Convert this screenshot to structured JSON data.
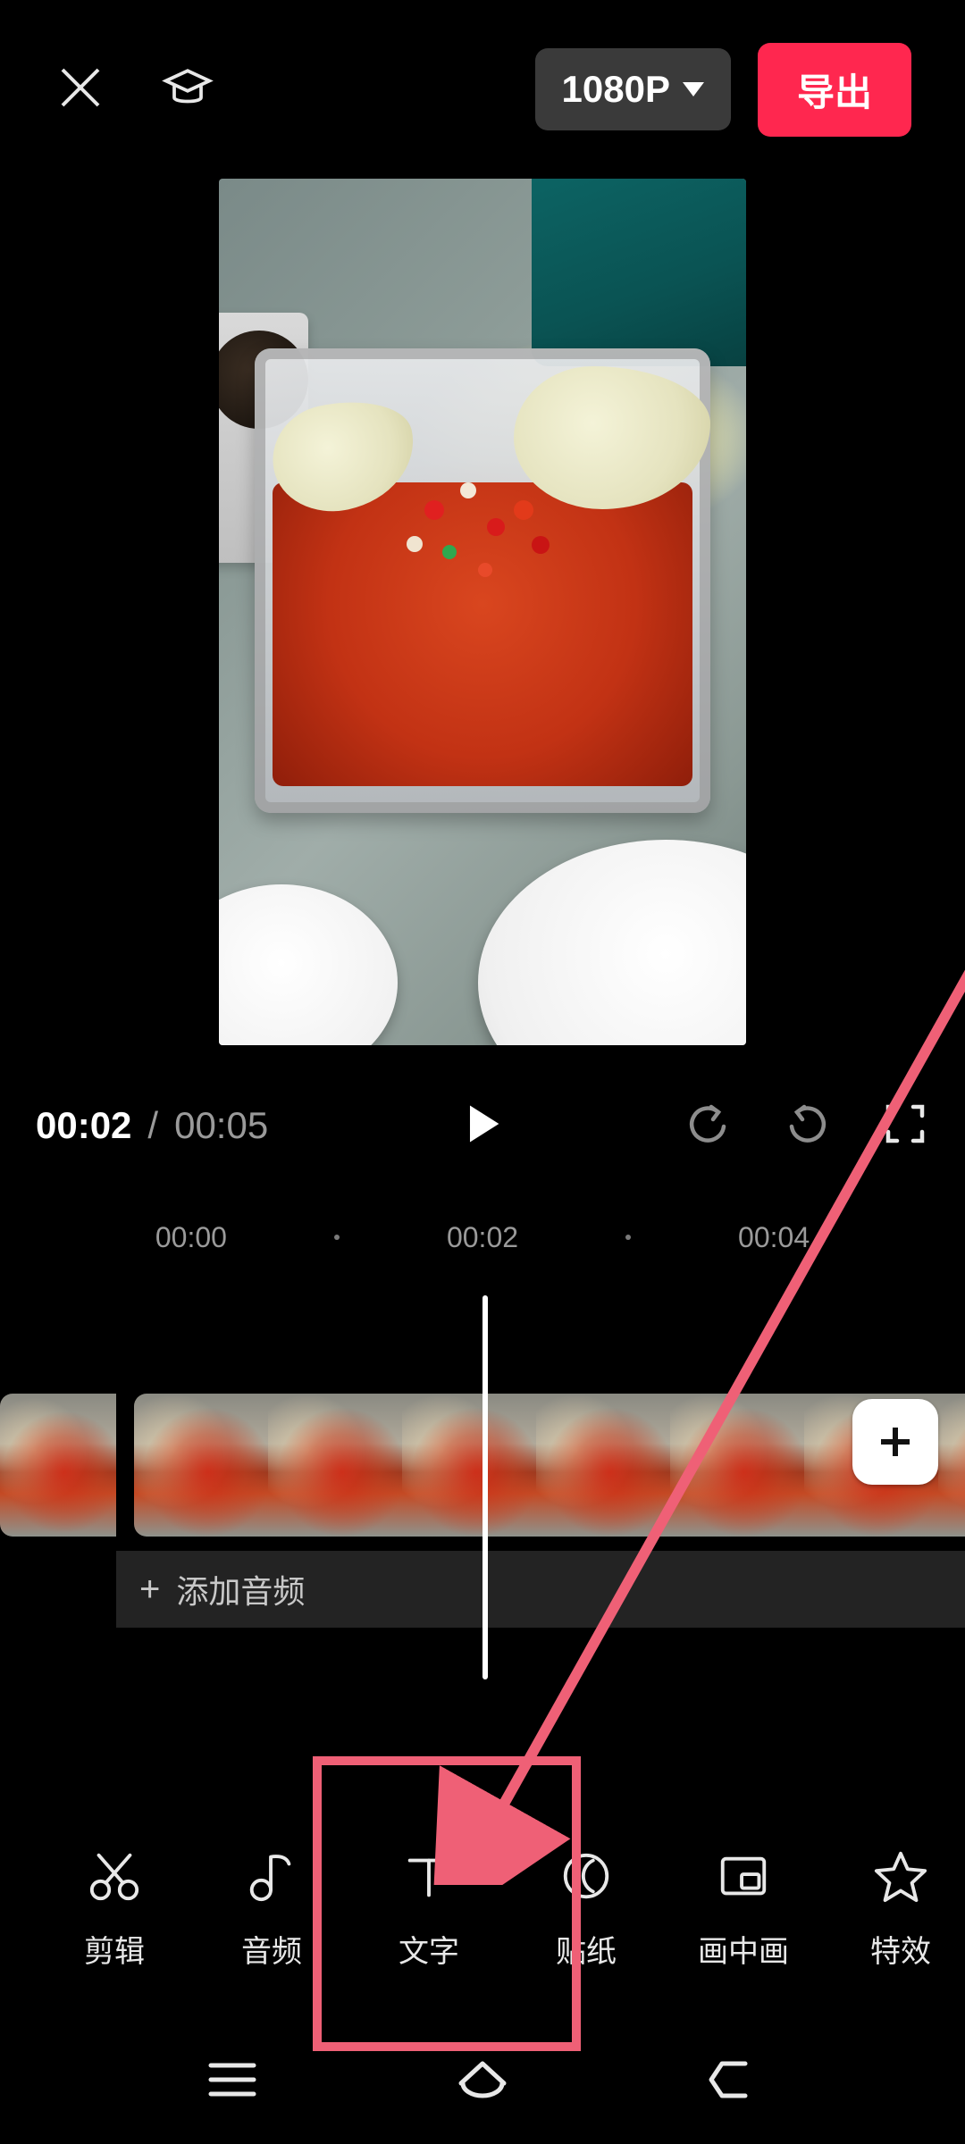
{
  "topbar": {
    "resolution_label": "1080P",
    "export_label": "导出"
  },
  "player": {
    "current_time": "00:02",
    "separator": "/",
    "total_time": "00:05"
  },
  "ruler": {
    "marks": [
      "00:00",
      "00:02",
      "00:04"
    ]
  },
  "audio_track": {
    "add_audio_label": "添加音频"
  },
  "tools": [
    {
      "id": "edit",
      "label": "剪辑",
      "icon": "scissors-icon"
    },
    {
      "id": "audio",
      "label": "音频",
      "icon": "music-note-icon"
    },
    {
      "id": "text",
      "label": "文字",
      "icon": "text-icon"
    },
    {
      "id": "sticker",
      "label": "贴纸",
      "icon": "moon-icon"
    },
    {
      "id": "pip",
      "label": "画中画",
      "icon": "pip-icon"
    },
    {
      "id": "effects",
      "label": "特效",
      "icon": "star-icon"
    }
  ],
  "annotation": {
    "highlighted_tool_id": "text"
  }
}
